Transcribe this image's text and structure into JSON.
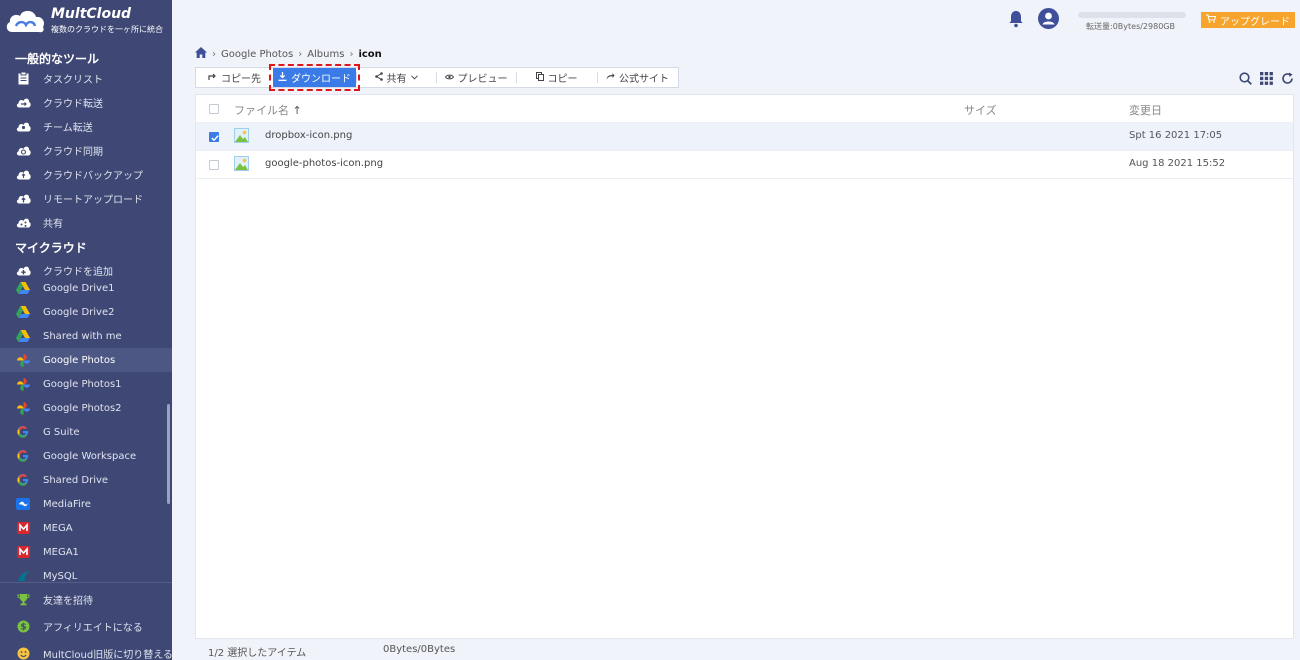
{
  "app": {
    "title": "MultCloud",
    "subtitle": "複数のクラウドを一ヶ所に統合"
  },
  "sidebar": {
    "tools_title": "一般的なツール",
    "tools": [
      {
        "label": "タスクリスト",
        "icon": "clipboard-icon"
      },
      {
        "label": "クラウド転送",
        "icon": "cloud-transfer-icon"
      },
      {
        "label": "チーム転送",
        "icon": "team-transfer-icon"
      },
      {
        "label": "クラウド同期",
        "icon": "cloud-sync-icon"
      },
      {
        "label": "クラウドバックアップ",
        "icon": "cloud-backup-icon"
      },
      {
        "label": "リモートアップロード",
        "icon": "remote-upload-icon"
      },
      {
        "label": "共有",
        "icon": "share-cloud-icon"
      }
    ],
    "my_cloud_title": "マイクラウド",
    "add_cloud": "クラウドを追加",
    "clouds": [
      {
        "label": "Google Drive1",
        "icon": "google-drive-icon"
      },
      {
        "label": "Google Drive2",
        "icon": "google-drive-icon"
      },
      {
        "label": "Shared with me",
        "icon": "google-drive-icon"
      },
      {
        "label": "Google Photos",
        "icon": "google-photos-icon"
      },
      {
        "label": "Google Photos1",
        "icon": "google-photos-icon"
      },
      {
        "label": "Google Photos2",
        "icon": "google-photos-icon"
      },
      {
        "label": "G Suite",
        "icon": "google-g-icon"
      },
      {
        "label": "Google Workspace",
        "icon": "google-g-icon"
      },
      {
        "label": "Shared Drive",
        "icon": "google-g-icon"
      },
      {
        "label": "MediaFire",
        "icon": "mediafire-icon"
      },
      {
        "label": "MEGA",
        "icon": "mega-icon"
      },
      {
        "label": "MEGA1",
        "icon": "mega-icon"
      },
      {
        "label": "MySQL",
        "icon": "mysql-icon"
      }
    ],
    "bottom": [
      {
        "label": "友達を招待",
        "icon": "trophy-icon"
      },
      {
        "label": "アフィリエイトになる",
        "icon": "dollar-icon"
      },
      {
        "label": "MultCloud旧版に切り替える",
        "icon": "smiley-icon"
      }
    ]
  },
  "header": {
    "quota": "転送量:0Bytes/2980GB",
    "upgrade": "アップグレード"
  },
  "breadcrumb": {
    "items": [
      "Google Photos",
      "Albums"
    ],
    "current": "icon"
  },
  "toolbar": {
    "copy_to": "コピー先",
    "download": "ダウンロード",
    "share": "共有",
    "preview": "プレビュー",
    "copy": "コピー",
    "official_site": "公式サイト"
  },
  "table": {
    "col_name": "ファイル名",
    "col_size": "サイズ",
    "col_modified": "変更日",
    "rows": [
      {
        "name": "dropbox-icon.png",
        "size": "",
        "modified": "Spt 16 2021 17:05",
        "checked": true
      },
      {
        "name": "google-photos-icon.png",
        "size": "",
        "modified": "Aug 18 2021 15:52",
        "checked": false
      }
    ]
  },
  "footer": {
    "selected": "1/2 選択したアイテム",
    "size": "0Bytes/0Bytes"
  },
  "colors": {
    "sidebar_bg": "#3f4874",
    "primary": "#3a7be8",
    "upgrade": "#f7a42c",
    "highlight_border": "#e01515"
  }
}
